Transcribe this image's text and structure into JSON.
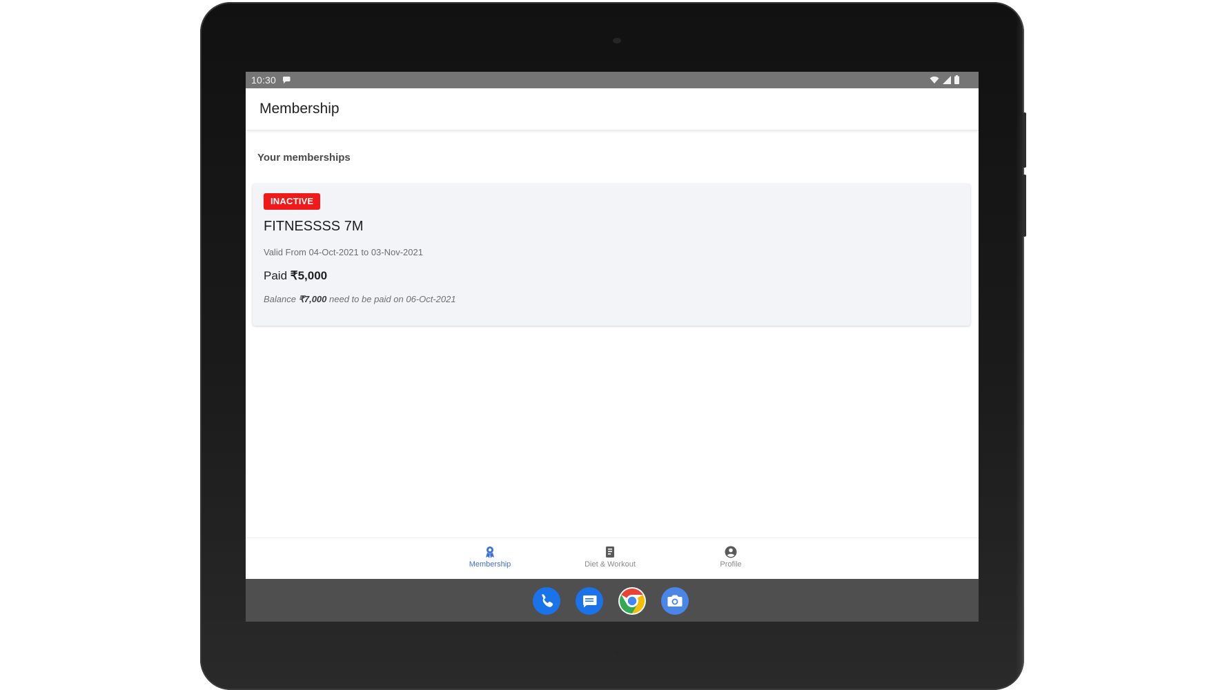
{
  "status_bar": {
    "time": "10:30"
  },
  "app_bar": {
    "title": "Membership"
  },
  "section": {
    "heading": "Your memberships"
  },
  "membership_card": {
    "status_badge": "INACTIVE",
    "plan_name": "FITNESSSS 7M",
    "validity": "Valid From 04-Oct-2021 to 03-Nov-2021",
    "paid_label": "Paid ",
    "paid_amount": "₹5,000",
    "balance_prefix": "Balance ",
    "balance_amount": "₹7,000",
    "balance_suffix": " need to be paid on 06-Oct-2021"
  },
  "bottom_nav": {
    "items": [
      {
        "label": "Membership",
        "icon": "membership-badge-icon",
        "active": true
      },
      {
        "label": "Diet & Workout",
        "icon": "clipboard-icon",
        "active": false
      },
      {
        "label": "Profile",
        "icon": "account-circle-icon",
        "active": false
      }
    ]
  },
  "dock": {
    "apps": [
      "phone-icon",
      "messages-icon",
      "chrome-icon",
      "camera-icon"
    ]
  },
  "colors": {
    "badge_red": "#f01a1a",
    "accent_blue": "#3d6fd8",
    "card_bg": "#f3f4f8",
    "status_bar_bg": "#757575",
    "dock_bg": "#4f4f4f"
  }
}
